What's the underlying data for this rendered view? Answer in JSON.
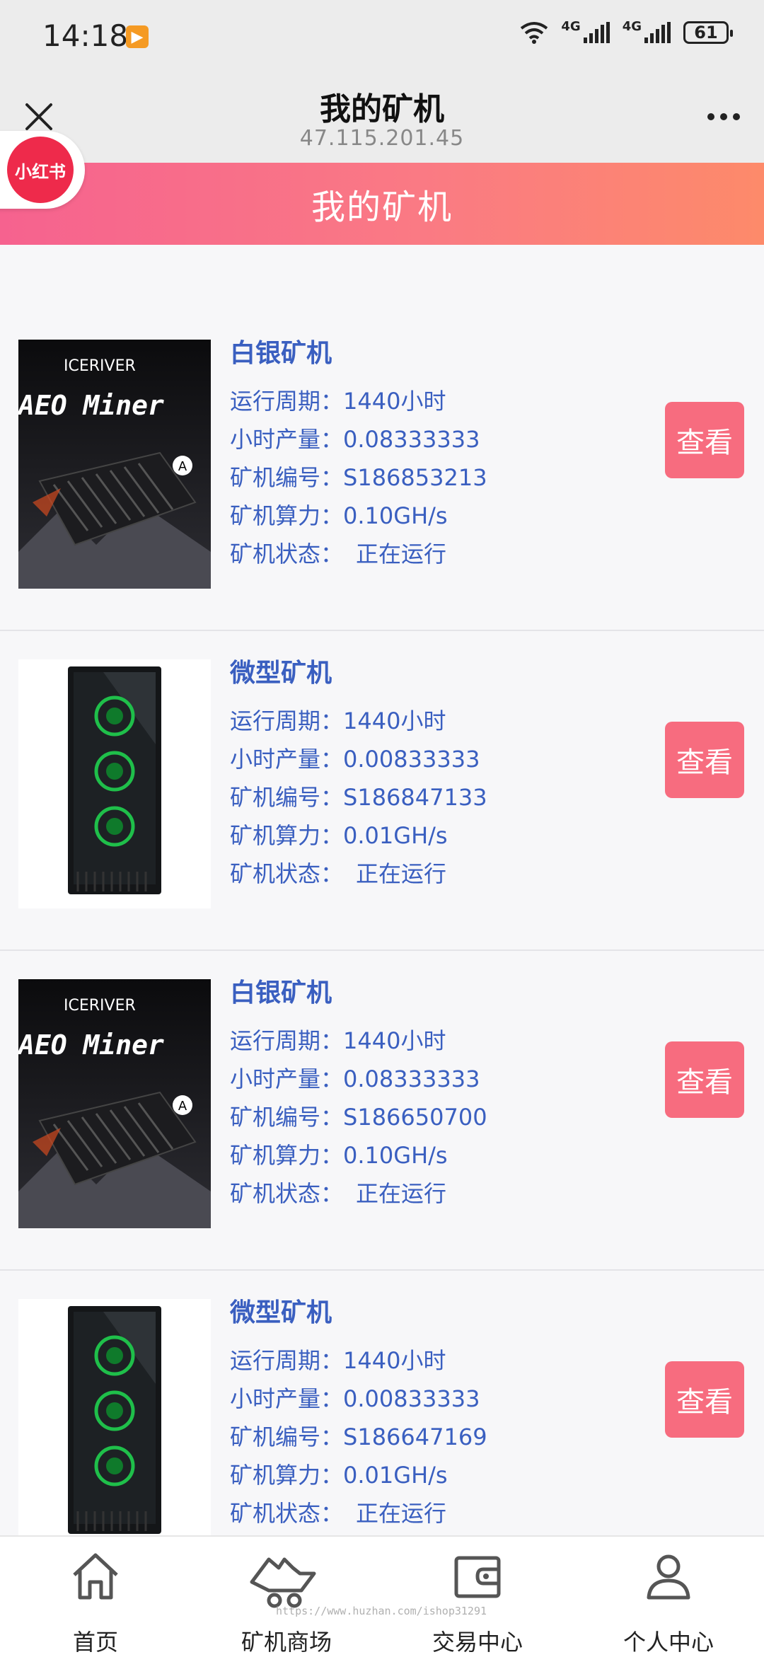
{
  "status_bar": {
    "time": "14:18",
    "net1": "4G",
    "net2": "4G",
    "battery": "61"
  },
  "nav": {
    "title": "我的矿机",
    "subtitle": "47.115.201.45"
  },
  "header": {
    "title": "我的矿机",
    "badge": "小红书"
  },
  "labels": {
    "cycle": "运行周期：",
    "output": "小时产量：",
    "serial": "矿机编号：",
    "power": "矿机算力：",
    "status": "矿机状态："
  },
  "thumb_text": {
    "brand": "ICERIVER",
    "model": "AEO Miner",
    "badge": "A"
  },
  "items": [
    {
      "name": "白银矿机",
      "cycle": "1440小时",
      "output": "0.08333333",
      "serial": "S186853213",
      "power": "0.10GH/s",
      "status": "正在运行",
      "button": "查看",
      "image": "iceriver-aeo-miner"
    },
    {
      "name": "微型矿机",
      "cycle": "1440小时",
      "output": "0.00833333",
      "serial": "S186847133",
      "power": "0.01GH/s",
      "status": "正在运行",
      "button": "查看",
      "image": "pc-tower"
    },
    {
      "name": "白银矿机",
      "cycle": "1440小时",
      "output": "0.08333333",
      "serial": "S186650700",
      "power": "0.10GH/s",
      "status": "正在运行",
      "button": "查看",
      "image": "iceriver-aeo-miner"
    },
    {
      "name": "微型矿机",
      "cycle": "1440小时",
      "output": "0.00833333",
      "serial": "S186647169",
      "power": "0.01GH/s",
      "status": "正在运行",
      "button": "查看",
      "image": "pc-tower"
    }
  ],
  "tabbar": [
    {
      "label": "首页",
      "icon": "home-icon"
    },
    {
      "label": "矿机商场",
      "icon": "mining-cart-icon"
    },
    {
      "label": "交易中心",
      "icon": "wallet-icon"
    },
    {
      "label": "个人中心",
      "icon": "user-icon"
    }
  ],
  "watermark": "https://www.huzhan.com/ishop31291"
}
